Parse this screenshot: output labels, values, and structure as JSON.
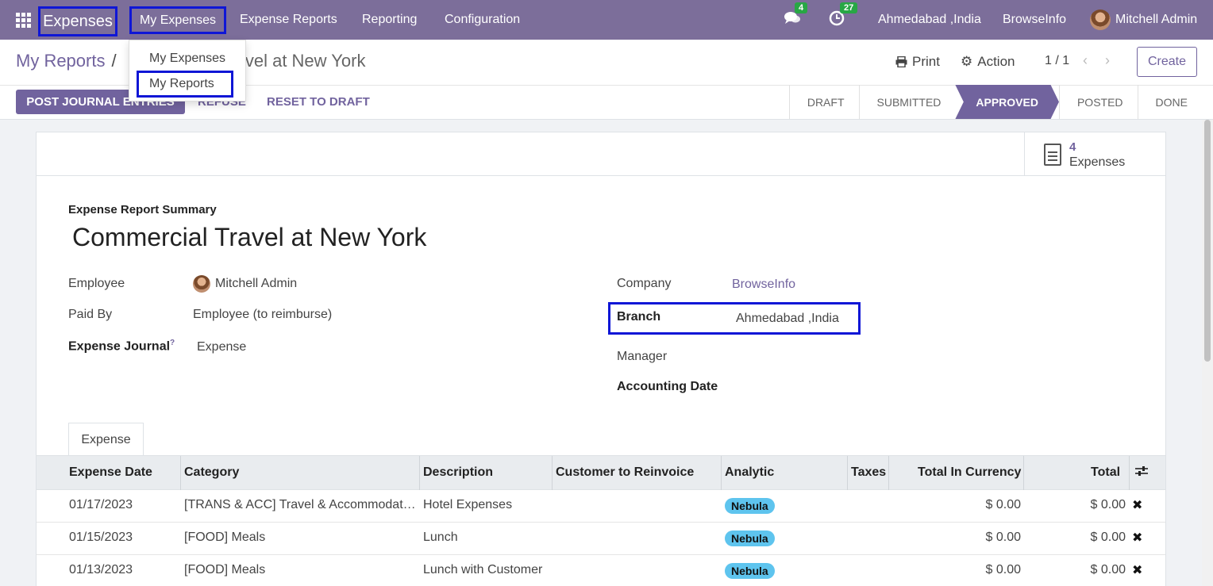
{
  "navbar": {
    "app_name": "Expenses",
    "menus": [
      "My Expenses",
      "Expense Reports",
      "Reporting",
      "Configuration"
    ],
    "messages_count": "4",
    "activities_count": "27",
    "branch": "Ahmedabad ,India",
    "company": "BrowseInfo",
    "user": "Mitchell Admin"
  },
  "dropdown": {
    "items": [
      "My Expenses",
      "My Reports"
    ]
  },
  "breadcrumb": {
    "parent": "My Reports",
    "separator": "/",
    "current": "avel at New York"
  },
  "control": {
    "print": "Print",
    "action": "Action",
    "pager": "1 / 1",
    "create": "Create"
  },
  "actions": {
    "post": "POST JOURNAL ENTRIES",
    "refuse": "REFUSE",
    "reset": "RESET TO DRAFT"
  },
  "stages": [
    "DRAFT",
    "SUBMITTED",
    "APPROVED",
    "POSTED",
    "DONE"
  ],
  "smart_button": {
    "count": "4",
    "label": "Expenses"
  },
  "form": {
    "summary_label": "Expense Report Summary",
    "title": "Commercial Travel at New York",
    "employee_label": "Employee",
    "employee_value": "Mitchell Admin",
    "paid_by_label": "Paid By",
    "paid_by_value": "Employee (to reimburse)",
    "journal_label": "Expense Journal",
    "journal_help": "?",
    "journal_value": "Expense",
    "company_label": "Company",
    "company_value": "BrowseInfo",
    "branch_label": "Branch",
    "branch_value": "Ahmedabad ,India",
    "manager_label": "Manager",
    "accounting_date_label": "Accounting Date"
  },
  "tab": "Expense",
  "table": {
    "headers": [
      "Expense Date",
      "Category",
      "Description",
      "Customer to Reinvoice",
      "Analytic",
      "Taxes",
      "Total In Currency",
      "Total"
    ],
    "rows": [
      {
        "date": "01/17/2023",
        "category": "[TRANS & ACC] Travel & Accommodat…",
        "description": "Hotel Expenses",
        "analytic": "Nebula",
        "total_currency": "$ 0.00",
        "total": "$ 0.00"
      },
      {
        "date": "01/15/2023",
        "category": "[FOOD] Meals",
        "description": "Lunch",
        "analytic": "Nebula",
        "total_currency": "$ 0.00",
        "total": "$ 0.00"
      },
      {
        "date": "01/13/2023",
        "category": "[FOOD] Meals",
        "description": "Lunch with Customer",
        "analytic": "Nebula",
        "total_currency": "$ 0.00",
        "total": "$ 0.00"
      }
    ]
  }
}
